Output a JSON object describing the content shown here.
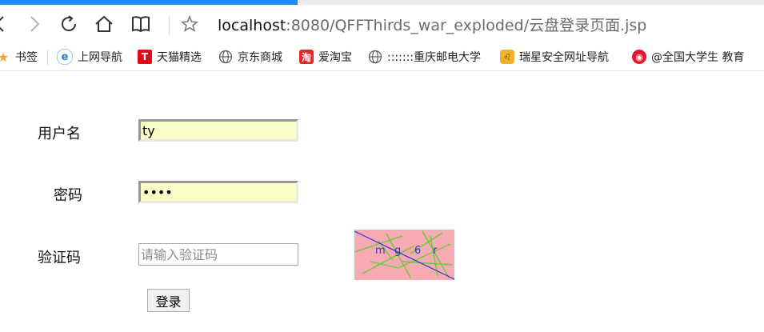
{
  "browser": {
    "progress": 0.39,
    "address": {
      "host": "localhost",
      "rest": ":8080/QFFThirds_war_exploded/云盘登录页面.jsp"
    },
    "bookmarks": [
      {
        "label": "书签",
        "icon": "star-icon"
      },
      {
        "label": "上网导航",
        "icon": "ie-e-icon"
      },
      {
        "label": "天猫精选",
        "icon": "tmall-icon"
      },
      {
        "label": "京东商城",
        "icon": "globe-icon"
      },
      {
        "label": "爱淘宝",
        "icon": "taobao-icon"
      },
      {
        "label": ":::::::重庆邮电大学",
        "icon": "globe-icon"
      },
      {
        "label": "瑞星安全网址导航",
        "icon": "lion-icon"
      },
      {
        "label": "@全国大学生 教育",
        "icon": "weibo-icon"
      }
    ]
  },
  "form": {
    "username_label": "用户名",
    "username_value": "ty",
    "password_label": "密码",
    "password_value": "••••",
    "captcha_label": "验证码",
    "captcha_placeholder": "请输入验证码",
    "captcha_text": [
      "m",
      "g",
      "6",
      "r"
    ],
    "login_label": "登录"
  },
  "colors": {
    "autofill_bg": "#fafec6",
    "captcha_bg": "#f7a9b4",
    "captcha_lines": "#66cc33",
    "captcha_text": "#3333cc",
    "progress": "#1d8cf8"
  }
}
